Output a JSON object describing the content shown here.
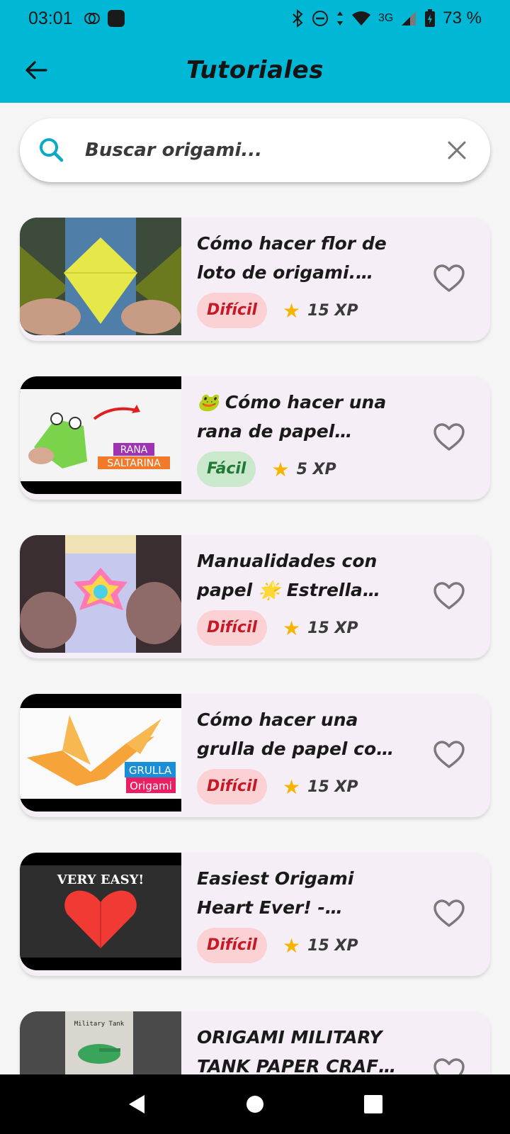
{
  "status_bar": {
    "time": "03:01",
    "network": "3G",
    "battery": "73 %"
  },
  "app_bar": {
    "title": "Tutoriales"
  },
  "search": {
    "placeholder": "Buscar origami..."
  },
  "tutorials": [
    {
      "title": "Cómo hacer flor de loto de origami. Ori...",
      "difficulty": "Difícil",
      "xp": "15 XP"
    },
    {
      "title": "🐸 Cómo hacer una rana de papel saltar...",
      "difficulty": "Fácil",
      "xp": "5 XP",
      "thumb_text_1": "RANA",
      "thumb_text_2": "SALTARINA"
    },
    {
      "title": "Manualidades con papel 🌟 Estrella inf...",
      "difficulty": "Difícil",
      "xp": "15 XP"
    },
    {
      "title": "Cómo hacer una grulla de papel con ...",
      "difficulty": "Difícil",
      "xp": "15 XP",
      "thumb_text_1": "GRULLA",
      "thumb_text_2": "Origami"
    },
    {
      "title": "Easiest Origami Heart Ever! - Tutorial in En...",
      "difficulty": "Difícil",
      "xp": "15 XP",
      "thumb_text_1": "VERY EASY!"
    },
    {
      "title": "ORIGAMI MILITARY TANK PAPER CRAFT T...",
      "difficulty": "",
      "xp": "",
      "thumb_text_1": "Military Tank"
    }
  ],
  "colors": {
    "accent": "#00b8d6",
    "card_bg": "#f6eef6",
    "hard_bg": "#fbd1d4",
    "hard_text": "#c21a26",
    "easy_bg": "#c9e8cc",
    "easy_text": "#207a33",
    "star": "#f5b400"
  }
}
